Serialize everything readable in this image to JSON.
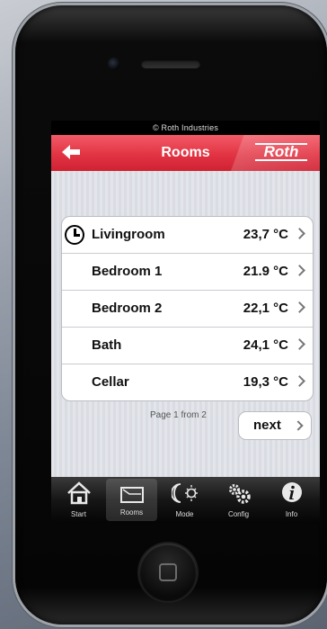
{
  "status_bar": {
    "text": "© Roth Industries"
  },
  "navbar": {
    "title": "Rooms",
    "logo_text": "Roth"
  },
  "rooms": [
    {
      "name": "Livingroom",
      "temp": "23,7 °C"
    },
    {
      "name": "Bedroom 1",
      "temp": "21.9 °C"
    },
    {
      "name": "Bedroom 2",
      "temp": "22,1 °C"
    },
    {
      "name": "Bath",
      "temp": "24,1 °C"
    },
    {
      "name": "Cellar",
      "temp": "19,3 °C"
    }
  ],
  "pager": {
    "text": "Page 1 from 2",
    "next_label": "next"
  },
  "tabs": [
    {
      "label": "Start",
      "icon": "house-icon"
    },
    {
      "label": "Rooms",
      "icon": "room-icon"
    },
    {
      "label": "Mode",
      "icon": "moon-sun-icon"
    },
    {
      "label": "Config",
      "icon": "gears-icon"
    },
    {
      "label": "Info",
      "icon": "info-icon"
    }
  ],
  "colors": {
    "accent": "#e23443",
    "tab_active": "#3b3b3b"
  }
}
